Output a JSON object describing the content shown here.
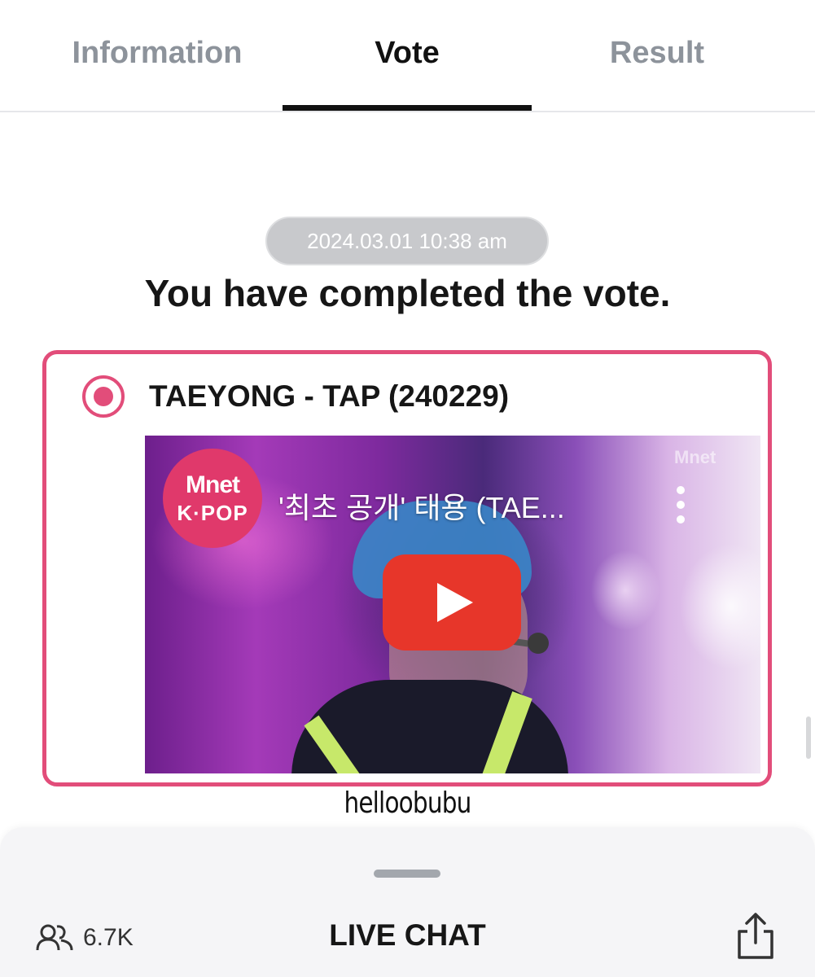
{
  "tabs": [
    {
      "label": "Information",
      "active": false
    },
    {
      "label": "Vote",
      "active": true
    },
    {
      "label": "Result",
      "active": false
    }
  ],
  "vote": {
    "timestamp": "2024.03.01 10:38 am",
    "status_message": "You have completed the vote.",
    "selected_option": {
      "title": "TAEYONG - TAP (240229)",
      "selected": true,
      "video": {
        "channel_logo_line1": "Mnet",
        "channel_logo_line2": "K·POP",
        "title": "'최초 공개' 태용 (TAE...",
        "watermark": "Mnet"
      }
    }
  },
  "overlay_text": "helloobubu",
  "bottom_sheet": {
    "viewer_count": "6.7K",
    "live_chat_label": "LIVE CHAT"
  },
  "colors": {
    "accent": "#e24d7a",
    "active_tab": "#111111",
    "inactive_tab": "#8d939b",
    "play_button": "#e7362a",
    "timestamp_pill": "#c8c9cc"
  },
  "icons": [
    "radio-selected-icon",
    "play-icon",
    "more-vertical-icon",
    "users-icon",
    "share-icon"
  ]
}
